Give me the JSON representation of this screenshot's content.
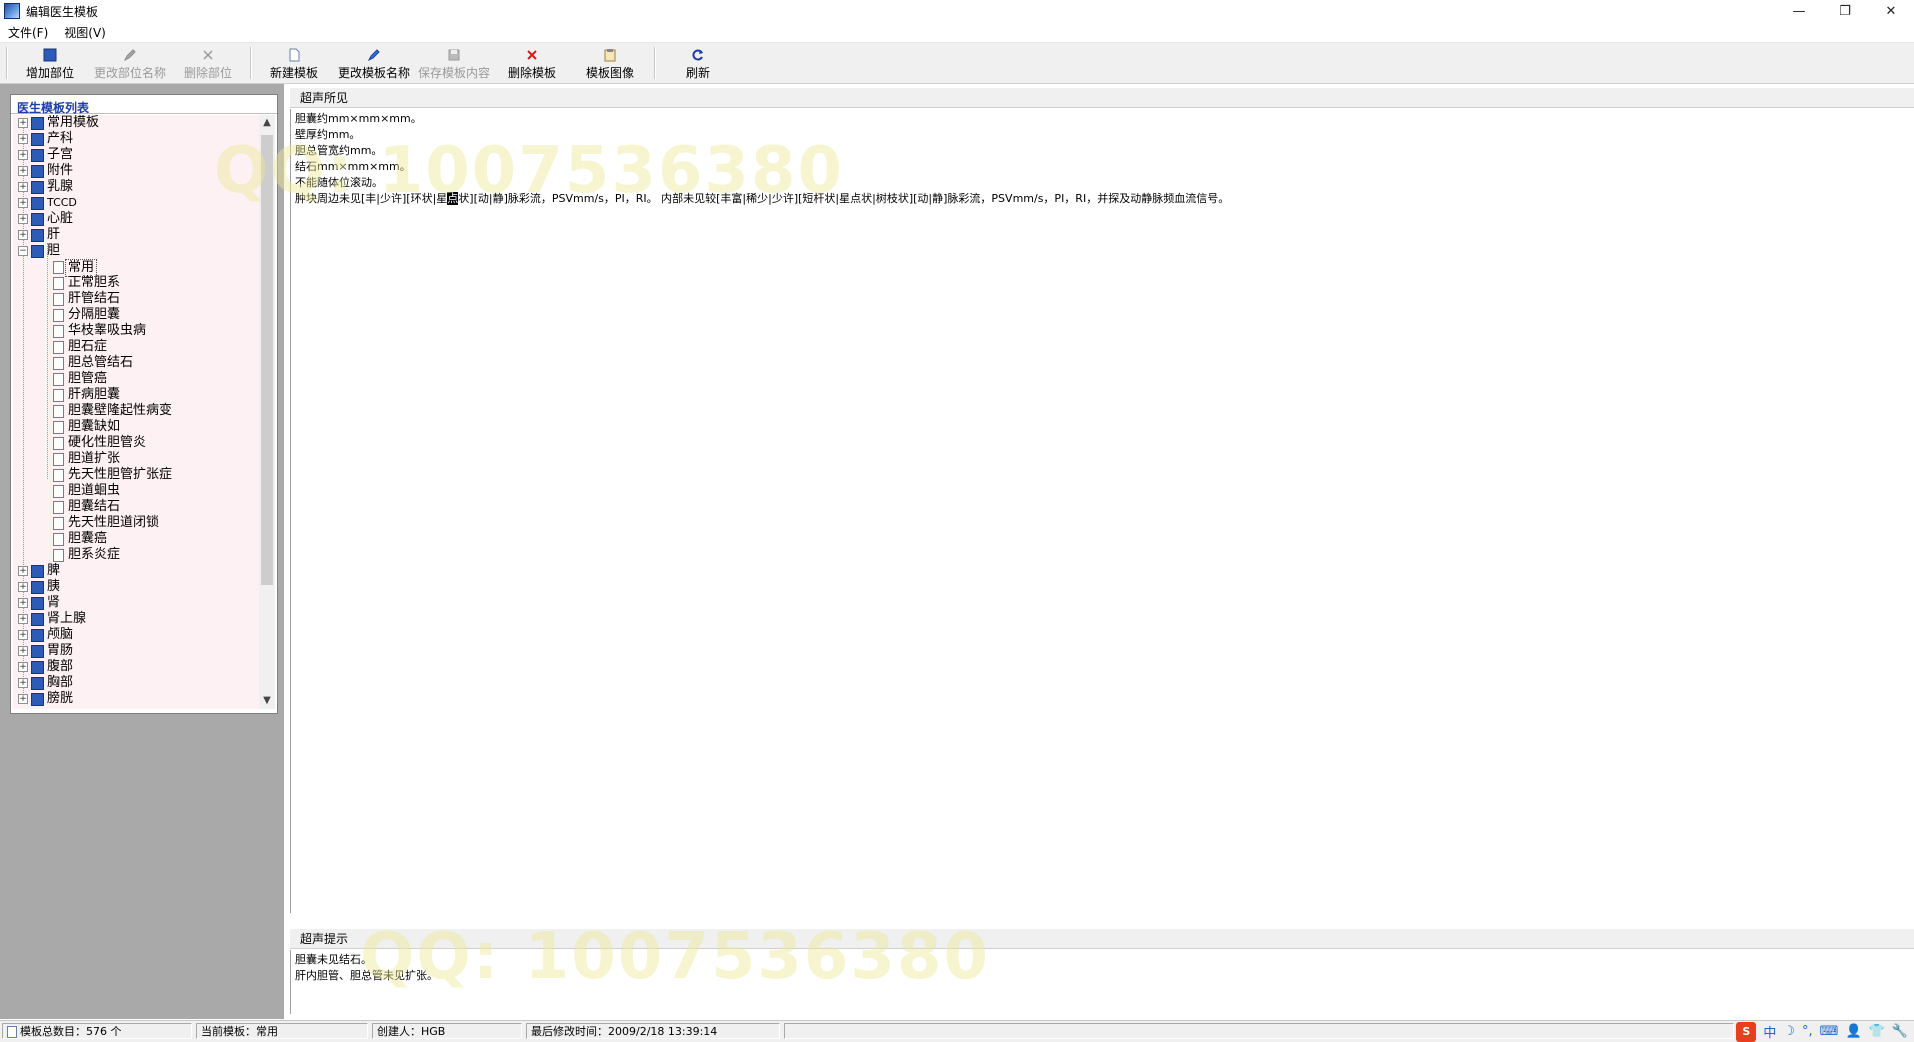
{
  "window": {
    "title": "编辑医生模板",
    "controls": [
      "—",
      "❐",
      "✕"
    ]
  },
  "menu": [
    "文件(F)",
    "视图(V)"
  ],
  "toolbar": [
    {
      "label": "增加部位",
      "icon": "add-part-icon",
      "enabled": true
    },
    {
      "label": "更改部位名称",
      "icon": "rename-part-icon",
      "enabled": false
    },
    {
      "label": "删除部位",
      "icon": "delete-part-icon",
      "enabled": false
    },
    {
      "label": "新建模板",
      "icon": "new-template-icon",
      "enabled": true
    },
    {
      "label": "更改模板名称",
      "icon": "rename-template-icon",
      "enabled": true
    },
    {
      "label": "保存模板内容",
      "icon": "save-template-icon",
      "enabled": false
    },
    {
      "label": "删除模板",
      "icon": "delete-template-icon",
      "enabled": true
    },
    {
      "label": "模板图像",
      "icon": "template-image-icon",
      "enabled": true
    },
    {
      "label": "刷新",
      "icon": "refresh-icon",
      "enabled": true
    }
  ],
  "tree": {
    "header": "医生模板列表",
    "groups_top": [
      "常用模板",
      "产科",
      "子宫",
      "附件",
      "乳腺",
      "TCCD",
      "心脏",
      "肝"
    ],
    "expanded_group": "胆",
    "expanded_children": [
      "常用",
      "正常胆系",
      "肝管结石",
      "分隔胆囊",
      "华枝睾吸虫病",
      "胆石症",
      "胆总管结石",
      "胆管癌",
      "肝病胆囊",
      "胆囊壁隆起性病变",
      "胆囊缺如",
      "硬化性胆管炎",
      "胆道扩张",
      "先天性胆管扩张症",
      "胆道蛔虫",
      "胆囊结石",
      "先天性胆道闭锁",
      "胆囊癌",
      "胆系炎症"
    ],
    "selected_child": "常用",
    "groups_bottom": [
      "脾",
      "胰",
      "肾",
      "肾上腺",
      "颅脑",
      "胃肠",
      "腹部",
      "胸部",
      "膀胱"
    ]
  },
  "findings": {
    "header": "超声所见",
    "lines": [
      "胆囊约mm×mm×mm。",
      "壁厚约mm。",
      "胆总管宽约mm。",
      "结石mm×mm×mm。",
      "不能随体位滚动。"
    ],
    "last_line_before": "肿块周边未见[丰|少许][环状|星",
    "last_line_caret": "点",
    "last_line_after": "状][动|静]脉彩流，PSVmm/s，PI，RI。 内部未见较[丰富|稀少|少许][短杆状|星点状|树枝状][动|静]脉彩流，PSVmm/s，PI，RI，并探及动静脉频血流信号。"
  },
  "hint": {
    "header": "超声提示",
    "lines": [
      "胆囊未见结石。",
      "肝内胆管、胆总管未见扩张。"
    ]
  },
  "watermark": "QQ: 1007536380",
  "status": {
    "total": "模板总数目：576 个",
    "current": "当前模板：常用",
    "creator": "创建人：HGB",
    "modified": "最后修改时间：2009/2/18 13:39:14"
  },
  "ime": {
    "logo": "S",
    "items": [
      "中",
      "☽",
      "°,",
      "⌨",
      "👤",
      "👕",
      "🔧"
    ]
  },
  "colors": {
    "tree_bg": "#fdf1f3",
    "header_blue": "#1d3fa6",
    "left_pane": "#a9a9a9",
    "book_blue": "#2c5bb8"
  }
}
